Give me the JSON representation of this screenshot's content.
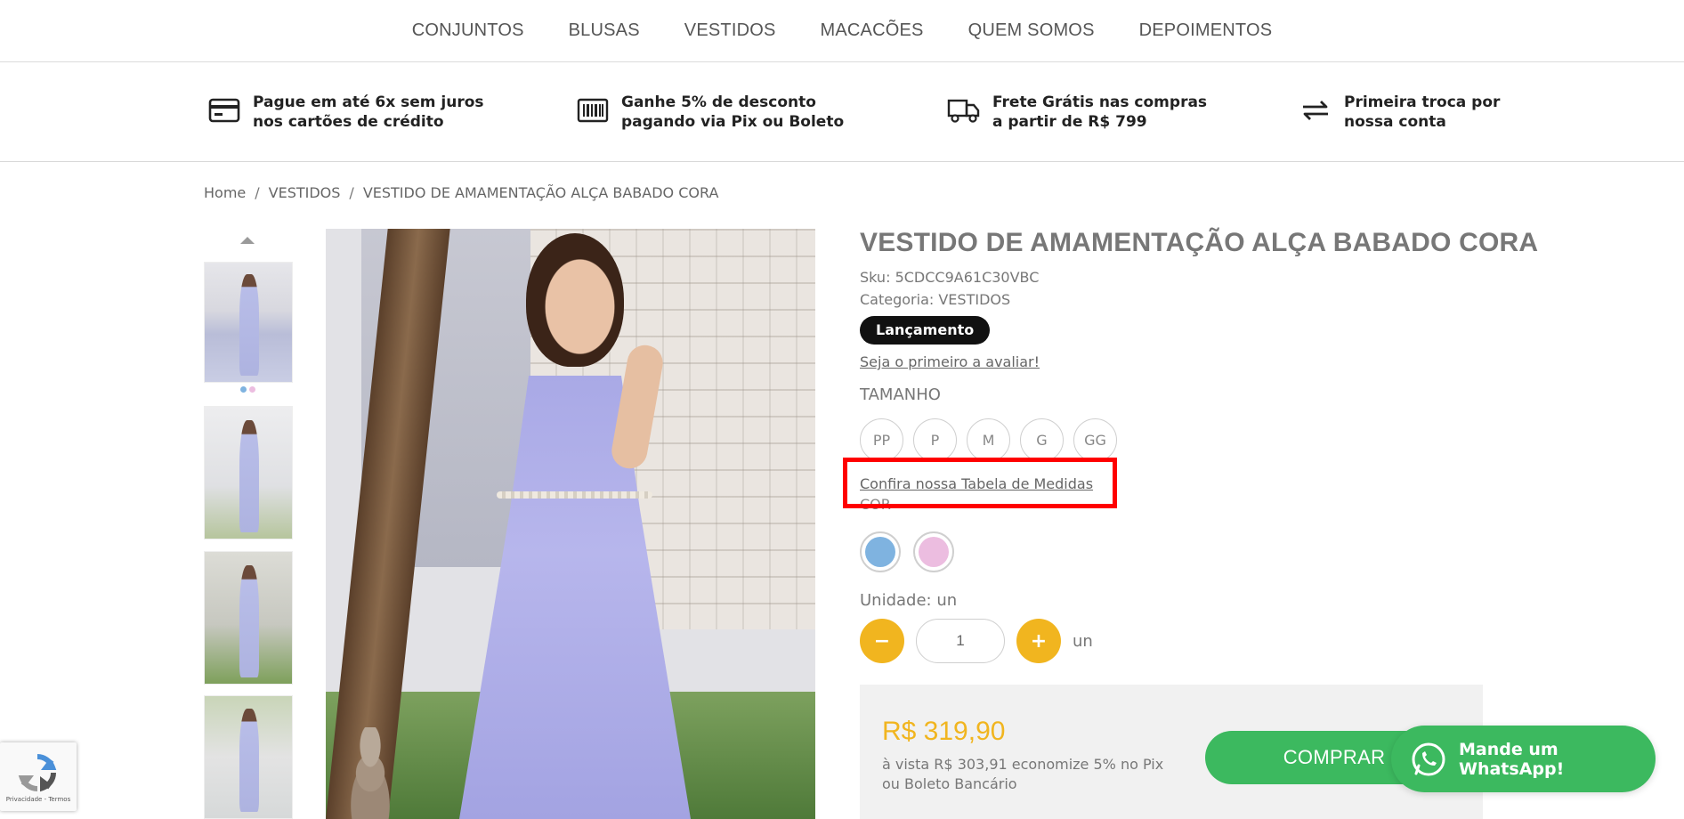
{
  "nav": {
    "items": [
      "CONJUNTOS",
      "BLUSAS",
      "VESTIDOS",
      "MACACÕES",
      "QUEM SOMOS",
      "DEPOIMENTOS"
    ]
  },
  "benefits": [
    {
      "icon": "credit-card-icon",
      "line1": "Pague em até 6x sem juros",
      "line2": "nos cartões de crédito"
    },
    {
      "icon": "barcode-icon",
      "line1": "Ganhe 5% de desconto",
      "line2": "pagando via Pix ou Boleto"
    },
    {
      "icon": "delivery-truck-icon",
      "line1": "Frete Grátis nas compras",
      "line2": "a partir de R$ 799"
    },
    {
      "icon": "exchange-arrows-icon",
      "line1": "Primeira troca por",
      "line2": "nossa conta"
    }
  ],
  "breadcrumb": {
    "home": "Home",
    "sep": "/",
    "category": "VESTIDOS",
    "current": "VESTIDO DE AMAMENTAÇÃO ALÇA BABADO CORA"
  },
  "product": {
    "title": "VESTIDO DE AMAMENTAÇÃO ALÇA BABADO CORA",
    "sku_label": "Sku:",
    "sku": "5CDCC9A61C30VBC",
    "category_label": "Categoria:",
    "category": "VESTIDOS",
    "badge": "Lançamento",
    "review_prompt": "Seja o primeiro a avaliar!",
    "size_label": "TAMANHO",
    "sizes": [
      "PP",
      "P",
      "M",
      "G",
      "GG"
    ],
    "measure_link": "Confira nossa Tabela de Medidas",
    "color_label": "COR",
    "colors": [
      "#7fb3e0",
      "#ecbde0"
    ],
    "unit_label": "Unidade: un",
    "quantity": "1",
    "qty_minus": "−",
    "qty_plus": "+",
    "qty_unit": "un",
    "price": "R$ 319,90",
    "pix_text": "à vista R$ 303,91 economize 5% no Pix ou Boleto Bancário",
    "buy_label": "COMPRAR"
  },
  "thumbnail_dot_colors": [
    "#7fb3e0",
    "#ecbde0"
  ],
  "whatsapp": {
    "label": "Mande um WhatsApp!"
  },
  "recaptcha": {
    "text": "Privacidade - Termos"
  },
  "colors": {
    "accent_yellow": "#f1b51f",
    "buy_green": "#3cb95f",
    "highlight_red": "#ff0000"
  }
}
